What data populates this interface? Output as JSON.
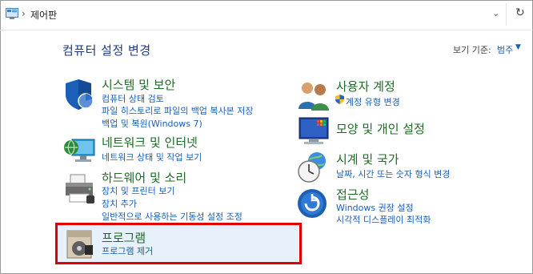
{
  "address_bar": {
    "location": "제어판"
  },
  "header": {
    "title": "컴퓨터 설정 변경",
    "view_by_label": "보기 기준:",
    "view_by_value": "범주"
  },
  "categories": [
    {
      "title": "시스템 및 보안",
      "links": [
        "컴퓨터 상태 검토",
        "파일 히스토리로 파일의 백업 복사본 저장",
        "백업 및 복원(Windows 7)"
      ]
    },
    {
      "title": "네트워크 및 인터넷",
      "links": [
        "네트워크 상태 및 작업 보기"
      ]
    },
    {
      "title": "하드웨어 및 소리",
      "links": [
        "장치 및 프린터 보기",
        "장치 추가",
        "일반적으로 사용하는 기동성 설정 조정"
      ]
    },
    {
      "title": "프로그램",
      "links": [
        "프로그램 제거"
      ]
    },
    {
      "title": "사용자 계정",
      "links": [
        "계정 유형 변경"
      ]
    },
    {
      "title": "모양 및 개인 설정",
      "links": []
    },
    {
      "title": "시계 및 국가",
      "links": [
        "날짜, 시간 또는 숫자 형식 변경"
      ]
    },
    {
      "title": "접근성",
      "links": [
        "Windows 권장 설정",
        "시각적 디스플레이 최적화"
      ]
    }
  ]
}
